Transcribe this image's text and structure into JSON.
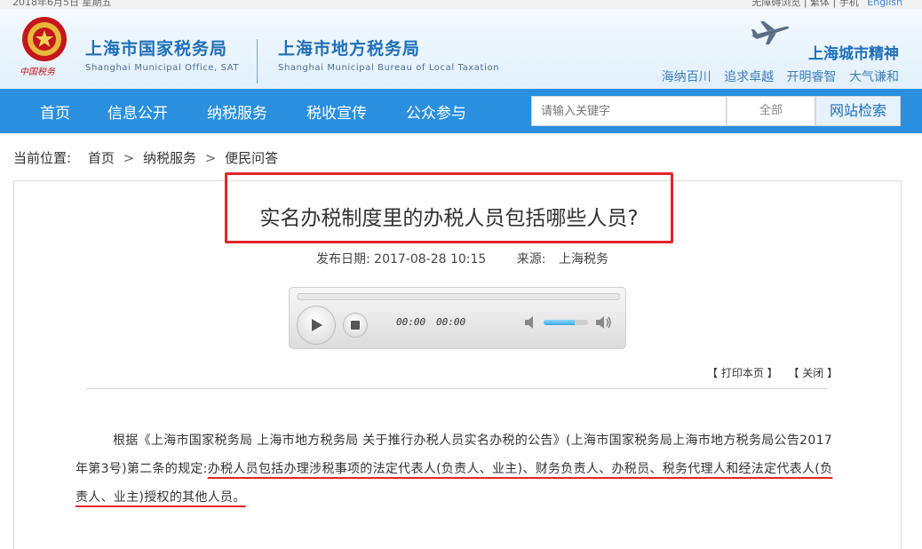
{
  "topbar": {
    "date": "2018年6月5日 星期五",
    "links": "无障碍浏览 | 繁体 | 手机",
    "english": "English"
  },
  "header": {
    "emblem_caption": "中国税务",
    "org1_cn": "上海市国家税务局",
    "org1_en": "Shanghai Municipal Office, SAT",
    "org2_cn": "上海市地方税务局",
    "org2_en": "Shanghai Municipal Bureau of Local Taxation",
    "slogan_title": "上海城市精神",
    "slogan_words": [
      "海纳百川",
      "追求卓越",
      "开明睿智",
      "大气谦和"
    ]
  },
  "nav": {
    "items": [
      "首页",
      "信息公开",
      "纳税服务",
      "税收宣传",
      "公众参与"
    ],
    "search_placeholder": "请输入关键字",
    "scope": "全部",
    "search_button": "网站检索"
  },
  "breadcrumb": {
    "label": "当前位置:",
    "items": [
      "首页",
      "纳税服务",
      "便民问答"
    ],
    "separator": ">"
  },
  "article": {
    "title": "实名办税制度里的办税人员包括哪些人员?",
    "date_label": "发布日期:",
    "date": "2017-08-28 10:15",
    "source_label": "来源:",
    "source": "上海税务",
    "print_label": "【 打印本页 】",
    "close_label": "【 关闭 】",
    "body_plain": "根据《上海市国家税务局 上海市地方税务局 关于推行办税人员实名办税的公告》(上海市国家税务局上海市地方税务局公告2017年第3号)第二条的规定:",
    "body_highlight": "办税人员包括办理涉税事项的法定代表人(负责人、业主)、财务负责人、办税员、税务代理人和经法定代表人(负责人、业主)授权的其他人员。"
  },
  "player": {
    "current_time": "00:00",
    "duration": "00:00",
    "volume": 0.7
  },
  "colors": {
    "nav": "#2a8fde",
    "brand": "#1e6fb8",
    "annotation": "#e0262b"
  }
}
